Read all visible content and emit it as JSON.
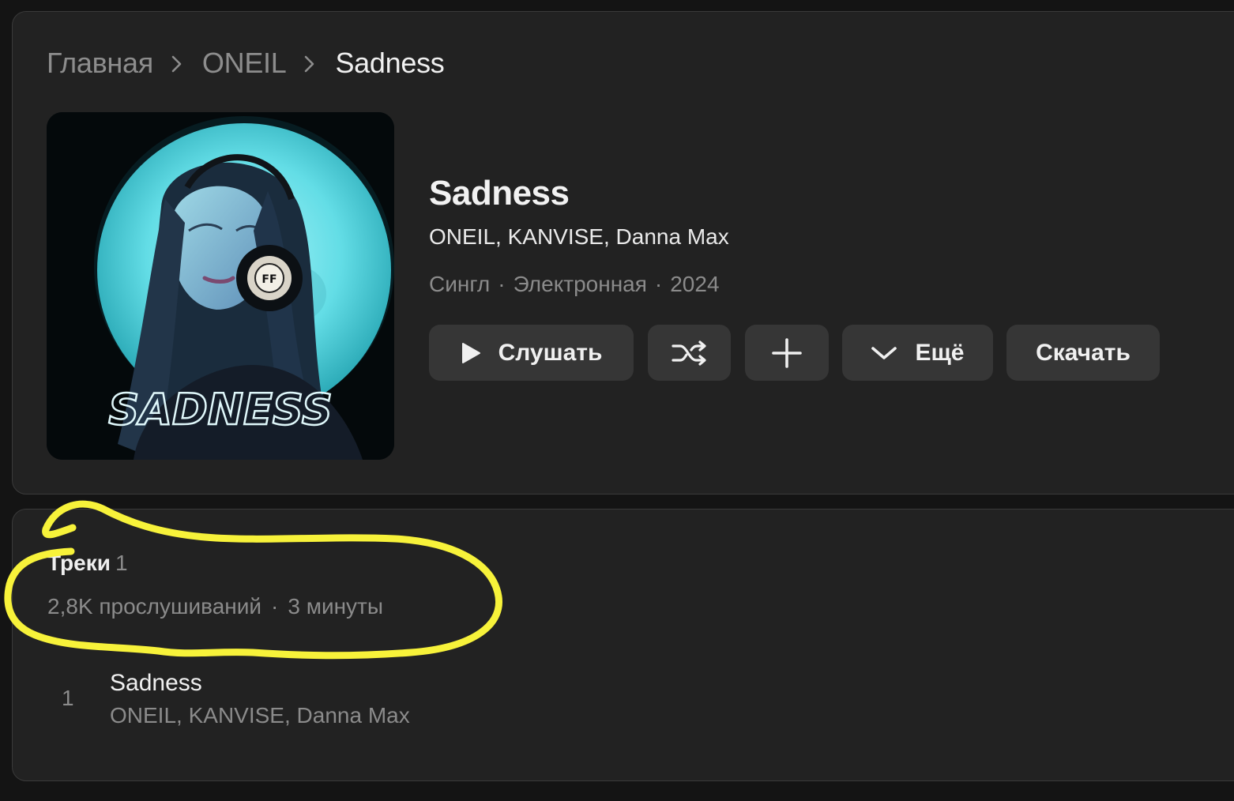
{
  "breadcrumb": {
    "home": "Главная",
    "artist": "ONEIL",
    "current": "Sadness"
  },
  "release": {
    "title": "Sadness",
    "artists": "ONEIL, KANVISE, Danna Max",
    "type": "Сингл",
    "genre": "Электронная",
    "year": "2024",
    "meta_separator": "·",
    "cover_text": "SADNESS",
    "cover_badge": "FF"
  },
  "actions": {
    "play_label": "Слушать",
    "more_label": "Ещё",
    "download_label": "Скачать",
    "play_icon": "play-icon",
    "shuffle_icon": "shuffle-icon",
    "add_icon": "plus-icon",
    "more_icon": "chevron-down-icon"
  },
  "tracks": {
    "heading": "Треки",
    "count": "1",
    "plays": "2,8K прослушиваний",
    "separator": "·",
    "duration": "3 минуты",
    "items": [
      {
        "number": "1",
        "title": "Sadness",
        "artists": "ONEIL, KANVISE, Danna Max"
      }
    ]
  },
  "colors": {
    "background": "#141414",
    "card": "#222222",
    "button": "#363636",
    "muted_text": "#8b8b8b",
    "annotation": "#f7f23a"
  }
}
